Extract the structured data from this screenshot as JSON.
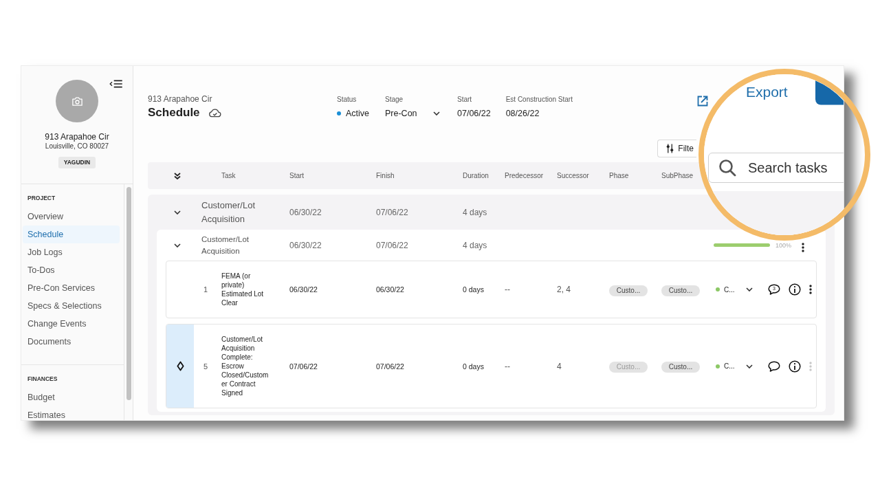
{
  "sidebar": {
    "project": {
      "name": "913 Arapahoe Cir",
      "address": "Louisville, CO 80027",
      "owner": "YAGUDIN"
    },
    "sections": [
      {
        "heading": "PROJECT",
        "items": [
          {
            "label": "Overview",
            "selected": false
          },
          {
            "label": "Schedule",
            "selected": true
          },
          {
            "label": "Job Logs",
            "selected": false
          },
          {
            "label": "To-Dos",
            "selected": false
          },
          {
            "label": "Pre-Con Services",
            "selected": false
          },
          {
            "label": "Specs & Selections",
            "selected": false
          },
          {
            "label": "Change Events",
            "selected": false
          },
          {
            "label": "Documents",
            "selected": false
          }
        ]
      },
      {
        "heading": "FINANCES",
        "items": [
          {
            "label": "Budget",
            "selected": false
          },
          {
            "label": "Estimates",
            "selected": false
          }
        ]
      }
    ]
  },
  "header": {
    "subtitle": "913 Arapahoe Cir",
    "title": "Schedule",
    "fields": [
      {
        "kind": "status",
        "label": "Status",
        "value": "Active",
        "color": "#1b8fd6"
      },
      {
        "kind": "dropdown",
        "label": "Stage",
        "value": "Pre-Con"
      },
      {
        "kind": "text",
        "label": "Start",
        "value": "07/06/22"
      },
      {
        "kind": "text",
        "label": "Est Construction Start",
        "value": "08/26/22"
      }
    ]
  },
  "toolbar": {
    "filter_button": "Filte"
  },
  "table": {
    "columns": [
      "Task",
      "Start",
      "Finish",
      "Duration",
      "Predecessor",
      "Successor",
      "Phase",
      "SubPhase"
    ],
    "groups": [
      {
        "kind": "group",
        "name": "Customer/Lot Acquisition",
        "start": "06/30/22",
        "finish": "07/06/22",
        "duration": "4 days",
        "expanded": true,
        "children": [
          {
            "kind": "group",
            "name": "Customer/Lot Acquisition",
            "start": "06/30/22",
            "finish": "07/06/22",
            "duration": "4 days",
            "expanded": true,
            "level": 1,
            "reading": "100%",
            "children": [
              {
                "kind": "task",
                "number": "1",
                "name": "FEMA (or private) Estimated Lot Clear",
                "start": "06/30/22",
                "finish": "06/30/22",
                "duration": "0 days",
                "predecessor": "--",
                "successor": "2, 4",
                "phase": {
                  "text": "Custo...",
                  "dimmed": false
                },
                "subphase": {
                  "text": "Custo...",
                  "dimmed": false
                },
                "status": {
                  "text": "C...",
                  "color": "#8cc866"
                },
                "comment_count": "3",
                "milestone": false,
                "more_disabled": false
              },
              {
                "kind": "task",
                "number": "5",
                "name": "Customer/Lot Acquisition Complete: Escrow Closed/Customer Contract Signed",
                "start": "07/06/22",
                "finish": "07/06/22",
                "duration": "0 days",
                "predecessor": "--",
                "successor": "4",
                "phase": {
                  "text": "Custo...",
                  "dimmed": true
                },
                "subphase": {
                  "text": "Custo...",
                  "dimmed": false
                },
                "status": {
                  "text": "C...",
                  "color": "#8cc866"
                },
                "milestone": true,
                "more_disabled": true
              }
            ]
          }
        ]
      }
    ]
  },
  "magnifier": {
    "export_link": "Export",
    "search": {
      "placeholder": "Search tasks"
    }
  }
}
